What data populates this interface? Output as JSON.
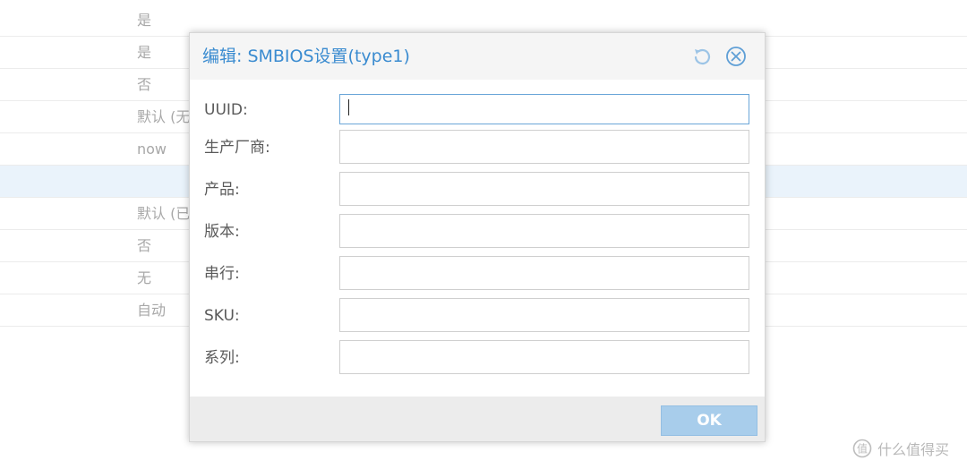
{
  "background_table": {
    "rows": [
      {
        "value": "是"
      },
      {
        "value": "是"
      },
      {
        "value": "否"
      },
      {
        "value": "默认 (无"
      },
      {
        "value": "now"
      },
      {
        "value": ""
      },
      {
        "value": "默认 (已"
      },
      {
        "value": "否"
      },
      {
        "value": "无"
      },
      {
        "value": "自动"
      }
    ],
    "selected_row": 5
  },
  "dialog": {
    "title": "编辑: SMBIOS设置(type1)",
    "reset_icon": "undo-icon",
    "close_icon": "close-circle-icon",
    "fields": [
      {
        "label": "UUID:",
        "value": ""
      },
      {
        "label": "生产厂商:",
        "value": ""
      },
      {
        "label": "产品:",
        "value": ""
      },
      {
        "label": "版本:",
        "value": ""
      },
      {
        "label": "串行:",
        "value": ""
      },
      {
        "label": "SKU:",
        "value": ""
      },
      {
        "label": "系列:",
        "value": ""
      }
    ],
    "ok_label": "OK"
  },
  "watermark": {
    "text": "什么值得买"
  },
  "colors": {
    "title": "#3a8bd0",
    "ok_button": "#a8cdeb",
    "selected_row": "#eaf3fb"
  }
}
